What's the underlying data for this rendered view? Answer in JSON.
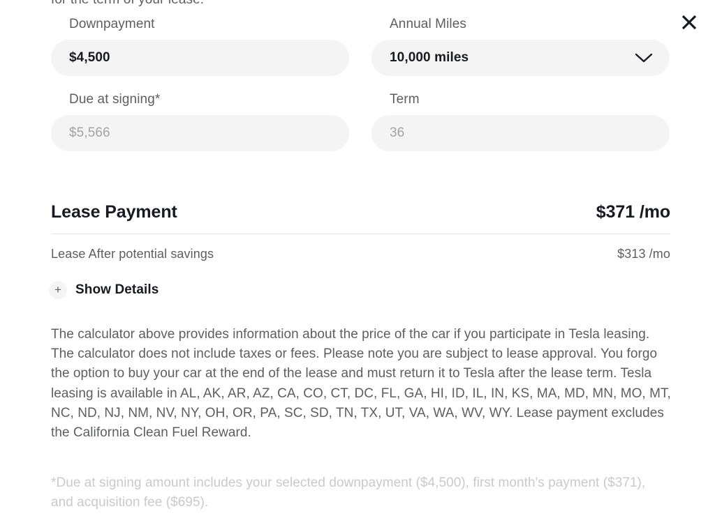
{
  "modal": {
    "clipped_top_text": "for the term of your lease.",
    "close_icon": "close-icon"
  },
  "fields": [
    {
      "label": "Downpayment",
      "value": "$4,500",
      "type": "text",
      "muted": false
    },
    {
      "label": "Annual Miles",
      "value": "10,000 miles",
      "type": "select",
      "muted": false,
      "chevron_icon": "chevron-down-icon"
    },
    {
      "label": "Due at signing*",
      "value": "$5,566",
      "type": "readonly",
      "muted": true
    },
    {
      "label": "Term",
      "value": "36",
      "type": "readonly",
      "muted": true
    }
  ],
  "summary": {
    "main_label": "Lease Payment",
    "main_value": "$371 /mo",
    "sub_label": "Lease After potential savings",
    "sub_value": "$313 /mo"
  },
  "show_details": {
    "label": "Show Details",
    "icon": "plus-icon"
  },
  "disclaimer": "The calculator above provides information about the price of the car if you participate in Tesla leasing. The calculator does not include taxes or fees. Please note you are subject to lease approval. You forgo the option to buy your car at the end of the lease and must return it to Tesla after the lease term. Tesla leasing is available in AL, AK, AR, AZ, CA, CO, CT, DC, FL, GA, HI, ID, IL, IN, KS, MA, MD, MN, MO, MT, NC, ND, NJ, NM, NV, NY, OH, OR, PA, SC, SD, TN, TX, UT, VA, WA, WV, WY. Lease payment excludes the California Clean Fuel Reward.",
  "footnote": "*Due at signing amount includes your selected downpayment ($4,500), first month's payment ($371), and acquisition fee ($695).",
  "colors": {
    "background": "#ffffff",
    "text_primary": "#171a20",
    "text_secondary": "#5c5e62",
    "text_muted": "#a2a3a5",
    "text_faint": "#c9cacb",
    "field_background": "#f4f4f4",
    "divider": "#e3e3e3"
  }
}
